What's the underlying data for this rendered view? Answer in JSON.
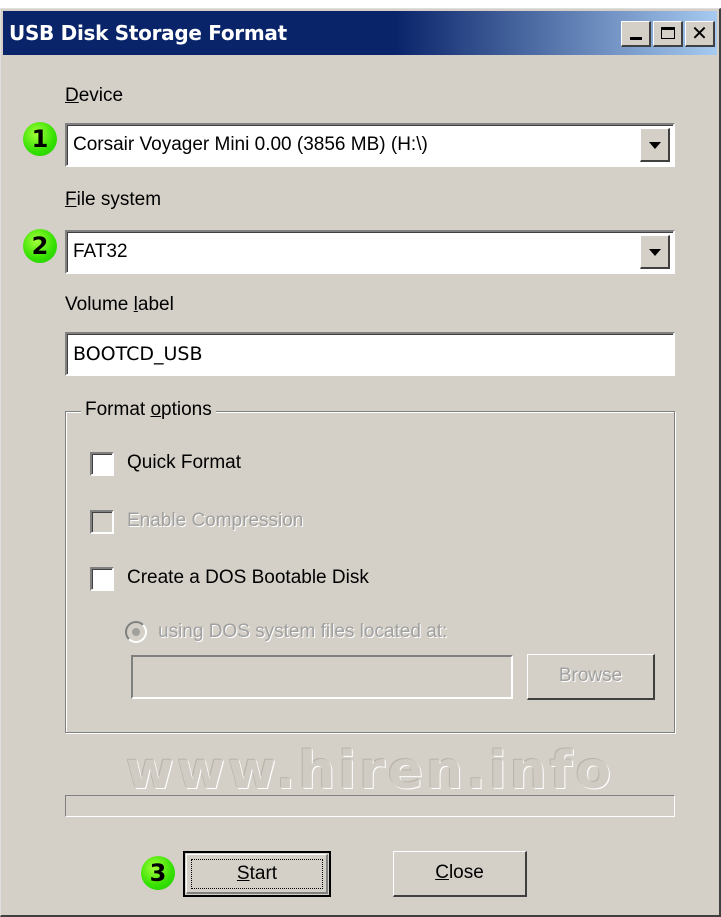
{
  "window": {
    "title": "USB Disk Storage Format"
  },
  "device": {
    "label_mnemonic": "D",
    "label_rest": "evice",
    "selected": "Corsair Voyager Mini 0.00 (3856 MB) (H:\\)"
  },
  "file_system": {
    "label_mnemonic": "F",
    "label_rest": "ile system",
    "selected": "FAT32"
  },
  "volume_label": {
    "label_before": "Volume ",
    "label_mnemonic": "l",
    "label_after": "abel",
    "value": "BOOTCD_USB"
  },
  "format_options": {
    "title_before": "Format ",
    "title_mnemonic": "o",
    "title_after": "ptions",
    "quick_format": {
      "label": "Quick Format",
      "checked": false,
      "enabled": true
    },
    "enable_compression": {
      "label": "Enable Compression",
      "checked": false,
      "enabled": false
    },
    "dos_bootable": {
      "label": "Create a DOS Bootable Disk",
      "checked": false,
      "enabled": true
    },
    "dos_files_radio": {
      "label": "using DOS system files located at:",
      "selected": true,
      "enabled": false
    },
    "dos_path": {
      "value": ""
    },
    "browse_label": "Browse"
  },
  "watermark": "www.hiren.info",
  "progress": {
    "fraction": 0
  },
  "buttons": {
    "start_mnemonic": "S",
    "start_rest": "tart",
    "close_mnemonic": "C",
    "close_rest": "lose"
  },
  "badges": {
    "one": "1",
    "two": "2",
    "three": "3"
  },
  "colors": {
    "titlebar_start": "#0a246a",
    "titlebar_end": "#a6caf0",
    "badge_green": "#33e000",
    "face": "#d4d0c8"
  }
}
